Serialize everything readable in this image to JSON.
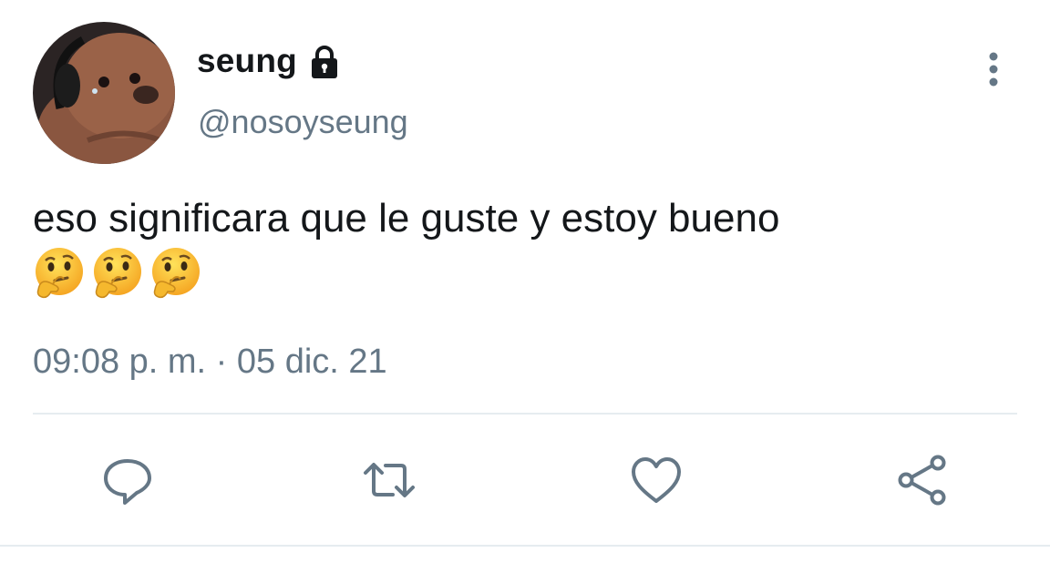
{
  "tweet": {
    "display_name": "seung",
    "handle": "@nosoyseung",
    "text": "eso significara que le guste y estoy bueno",
    "emojis": [
      "thinking-face",
      "thinking-face",
      "thinking-face"
    ],
    "timestamp": "09:08 p. m. · 05 dic. 21",
    "protected": true
  },
  "icons": {
    "lock": "lock-icon",
    "more": "more-vertical-icon",
    "reply": "reply-icon",
    "retweet": "retweet-icon",
    "like": "heart-icon",
    "share": "share-icon"
  },
  "colors": {
    "text_primary": "#14171a",
    "text_secondary": "#657786",
    "divider": "#e6ecf0"
  }
}
